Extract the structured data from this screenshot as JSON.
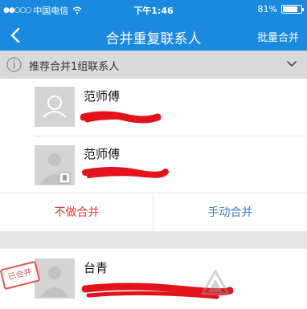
{
  "status_bar": {
    "signal_dots": "●●○○○",
    "carrier": "中国电信",
    "wifi_icon": "wifi-icon",
    "time": "下午1:46",
    "battery_percent": "81%",
    "battery_level": 0.81
  },
  "nav": {
    "back_icon": "chevron-left-icon",
    "title": "合并重复联系人",
    "batch_merge_label": "批量合并"
  },
  "notice": {
    "info_icon": "info-circle-icon",
    "text": "推荐合并1组联系人",
    "toggle_icon": "chevron-down-icon"
  },
  "contacts": [
    {
      "name": "范师傅",
      "avatar_icon": "person-placeholder-icon"
    },
    {
      "name": "范师傅",
      "avatar_icon": "person-sim-icon"
    },
    {
      "name": "台青",
      "avatar_icon": "person-sim-icon",
      "stamp": "已合并"
    }
  ],
  "actions": {
    "skip_label": "不做合并",
    "manual_label": "手动合并"
  },
  "colors": {
    "brand_blue": "#1a8ae0",
    "danger_red": "#e53935",
    "action_blue": "#3a7dc8"
  }
}
